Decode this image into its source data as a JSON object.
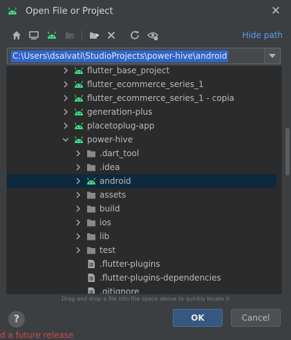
{
  "window": {
    "title": "Open File or Project",
    "close_label": "✕"
  },
  "toolbar": {
    "buttons": [
      "home-icon",
      "desktop-icon",
      "android-project-icon",
      "module-icon",
      "new-folder-icon",
      "delete-icon",
      "refresh-icon",
      "show-hidden-icon"
    ],
    "hide_path_label": "Hide path"
  },
  "path": {
    "value": "C:\\Users\\dsalvati\\StudioProjects\\power-hive\\android"
  },
  "tree": {
    "rows": [
      {
        "label": "flutter_base_project",
        "depth": 0,
        "expanded": false,
        "icon": "android"
      },
      {
        "label": "flutter_ecommerce_series_1",
        "depth": 0,
        "expanded": false,
        "icon": "android"
      },
      {
        "label": "flutter_ecommerce_series_1 - copia",
        "depth": 0,
        "expanded": false,
        "icon": "android"
      },
      {
        "label": "generation-plus",
        "depth": 0,
        "expanded": false,
        "icon": "android"
      },
      {
        "label": "placetoplug-app",
        "depth": 0,
        "expanded": false,
        "icon": "android"
      },
      {
        "label": "power-hive",
        "depth": 0,
        "expanded": true,
        "icon": "android"
      },
      {
        "label": ".dart_tool",
        "depth": 1,
        "expanded": false,
        "icon": "folder"
      },
      {
        "label": ".idea",
        "depth": 1,
        "expanded": false,
        "icon": "folder"
      },
      {
        "label": "android",
        "depth": 1,
        "expanded": false,
        "icon": "android",
        "selected": true
      },
      {
        "label": "assets",
        "depth": 1,
        "expanded": false,
        "icon": "folder"
      },
      {
        "label": "build",
        "depth": 1,
        "expanded": false,
        "icon": "folder"
      },
      {
        "label": "ios",
        "depth": 1,
        "expanded": false,
        "icon": "folder"
      },
      {
        "label": "lib",
        "depth": 1,
        "expanded": false,
        "icon": "folder"
      },
      {
        "label": "test",
        "depth": 1,
        "expanded": false,
        "icon": "folder"
      },
      {
        "label": ".flutter-plugins",
        "depth": 1,
        "expanded": null,
        "icon": "file"
      },
      {
        "label": ".flutter-plugins-dependencies",
        "depth": 1,
        "expanded": null,
        "icon": "file"
      },
      {
        "label": ".gitignore",
        "depth": 1,
        "expanded": null,
        "icon": "file"
      }
    ]
  },
  "hint": "Drag and drop a file into the space above to quickly locate it",
  "buttons": {
    "help_label": "?",
    "ok_label": "OK",
    "cancel_label": "Cancel"
  },
  "background_text": "d a future release",
  "colors": {
    "android_green": "#3ddc84",
    "link": "#589df6",
    "selection": "#0d293e"
  }
}
